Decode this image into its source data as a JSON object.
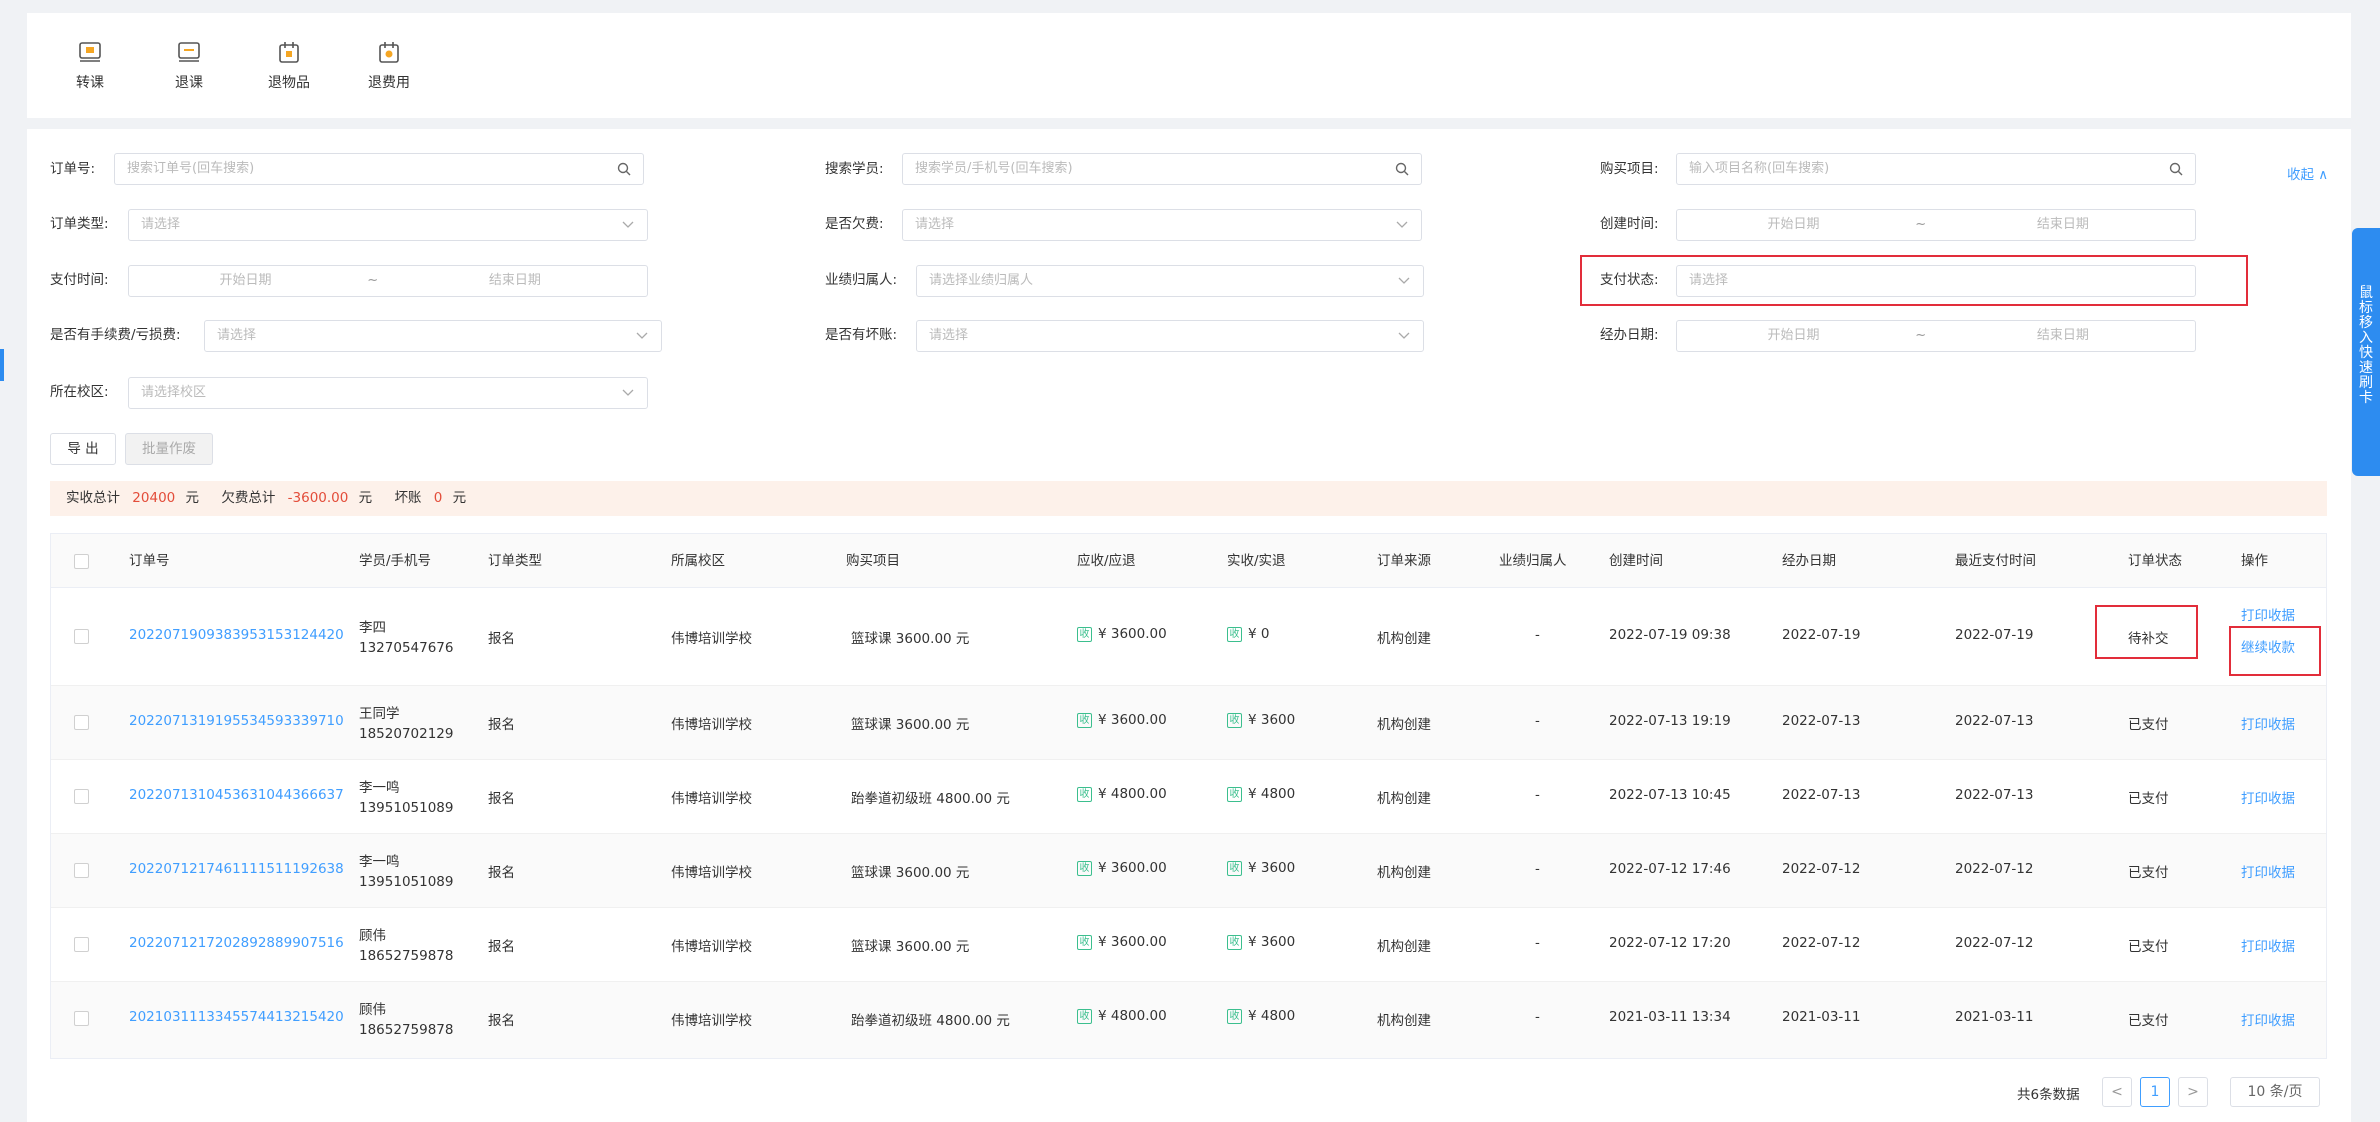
{
  "toolbar": {
    "items": [
      {
        "label": "转课",
        "icon": "transfer-course-icon"
      },
      {
        "label": "退课",
        "icon": "refund-course-icon"
      },
      {
        "label": "退物品",
        "icon": "return-goods-icon"
      },
      {
        "label": "退费用",
        "icon": "refund-fee-icon"
      }
    ]
  },
  "filters": {
    "order_no": {
      "label": "订单号:",
      "placeholder": "搜索订单号(回车搜索)"
    },
    "student": {
      "label": "搜索学员:",
      "placeholder": "搜索学员/手机号(回车搜索)"
    },
    "project": {
      "label": "购买项目:",
      "placeholder": "输入项目名称(回车搜索)"
    },
    "order_type": {
      "label": "订单类型:",
      "placeholder": "请选择"
    },
    "arrears": {
      "label": "是否欠费:",
      "placeholder": "请选择"
    },
    "create_time": {
      "label": "创建时间:",
      "start": "开始日期",
      "sep": "~",
      "end": "结束日期"
    },
    "pay_time": {
      "label": "支付时间:",
      "start": "开始日期",
      "sep": "~",
      "end": "结束日期"
    },
    "owner": {
      "label": "业绩归属人:",
      "placeholder": "请选择业绩归属人"
    },
    "pay_status": {
      "label": "支付状态:",
      "placeholder": "请选择"
    },
    "fee": {
      "label": "是否有手续费/亏损费:",
      "placeholder": "请选择"
    },
    "bad_debt": {
      "label": "是否有坏账:",
      "placeholder": "请选择"
    },
    "handle_date": {
      "label": "经办日期:",
      "start": "开始日期",
      "sep": "~",
      "end": "结束日期"
    },
    "campus": {
      "label": "所在校区:",
      "placeholder": "请选择校区"
    },
    "collapse": "收起 ∧"
  },
  "actions": {
    "export": "导 出",
    "batch_void": "批量作废"
  },
  "summary": {
    "received_label": "实收总计",
    "received": "20400",
    "unit1": "元",
    "arrears_label": "欠费总计",
    "arrears": "-3600.00",
    "unit2": "元",
    "bad_label": "坏账",
    "bad": "0",
    "unit3": "元"
  },
  "table": {
    "headers": [
      "订单号",
      "学员/手机号",
      "订单类型",
      "所属校区",
      "购买项目",
      "应收/应退",
      "实收/实退",
      "订单来源",
      "业绩归属人",
      "创建时间",
      "经办日期",
      "最近支付时间",
      "订单状态",
      "操作"
    ],
    "tag": "收",
    "rows": [
      {
        "order": "2022071909383953153124420",
        "name": "李四",
        "phone": "13270547676",
        "type": "报名",
        "campus": "伟博培训学校",
        "project": "篮球课 3600.00 元",
        "due": "¥ 3600.00",
        "paid": "¥ 0",
        "source": "机构创建",
        "owner": "-",
        "created": "2022-07-19 09:38",
        "handled": "2022-07-19",
        "last_pay": "2022-07-19",
        "status": "待补交",
        "ops": [
          "打印收据",
          "继续收款"
        ]
      },
      {
        "order": "2022071319195534593339710",
        "name": "王同学",
        "phone": "18520702129",
        "type": "报名",
        "campus": "伟博培训学校",
        "project": "篮球课 3600.00 元",
        "due": "¥ 3600.00",
        "paid": "¥ 3600",
        "source": "机构创建",
        "owner": "-",
        "created": "2022-07-13 19:19",
        "handled": "2022-07-13",
        "last_pay": "2022-07-13",
        "status": "已支付",
        "ops": [
          "打印收据"
        ]
      },
      {
        "order": "2022071310453631044366637",
        "name": "李一鸣",
        "phone": "13951051089",
        "type": "报名",
        "campus": "伟博培训学校",
        "project": "跆拳道初级班 4800.00 元",
        "due": "¥ 4800.00",
        "paid": "¥ 4800",
        "source": "机构创建",
        "owner": "-",
        "created": "2022-07-13 10:45",
        "handled": "2022-07-13",
        "last_pay": "2022-07-13",
        "status": "已支付",
        "ops": [
          "打印收据"
        ]
      },
      {
        "order": "2022071217461111511192638",
        "name": "李一鸣",
        "phone": "13951051089",
        "type": "报名",
        "campus": "伟博培训学校",
        "project": "篮球课 3600.00 元",
        "due": "¥ 3600.00",
        "paid": "¥ 3600",
        "source": "机构创建",
        "owner": "-",
        "created": "2022-07-12 17:46",
        "handled": "2022-07-12",
        "last_pay": "2022-07-12",
        "status": "已支付",
        "ops": [
          "打印收据"
        ]
      },
      {
        "order": "2022071217202892889907516",
        "name": "顾伟",
        "phone": "18652759878",
        "type": "报名",
        "campus": "伟博培训学校",
        "project": "篮球课 3600.00 元",
        "due": "¥ 3600.00",
        "paid": "¥ 3600",
        "source": "机构创建",
        "owner": "-",
        "created": "2022-07-12 17:20",
        "handled": "2022-07-12",
        "last_pay": "2022-07-12",
        "status": "已支付",
        "ops": [
          "打印收据"
        ]
      },
      {
        "order": "2021031113345574413215420",
        "name": "顾伟",
        "phone": "18652759878",
        "type": "报名",
        "campus": "伟博培训学校",
        "project": "跆拳道初级班 4800.00 元",
        "due": "¥ 4800.00",
        "paid": "¥ 4800",
        "source": "机构创建",
        "owner": "-",
        "created": "2021-03-11 13:34",
        "handled": "2021-03-11",
        "last_pay": "2021-03-11",
        "status": "已支付",
        "ops": [
          "打印收据"
        ]
      }
    ]
  },
  "pagination": {
    "total": "共6条数据",
    "prev": "<",
    "page": "1",
    "next": ">",
    "size": "10 条/页"
  },
  "side_tab": {
    "text": "鼠标移入 快速刷卡"
  },
  "colors": {
    "accent": "#409eff",
    "danger": "#e22d3a",
    "summary_bg": "#fdf1ea",
    "money_tag": "#3bbf8e",
    "side_tab": "#2d8cf0"
  }
}
